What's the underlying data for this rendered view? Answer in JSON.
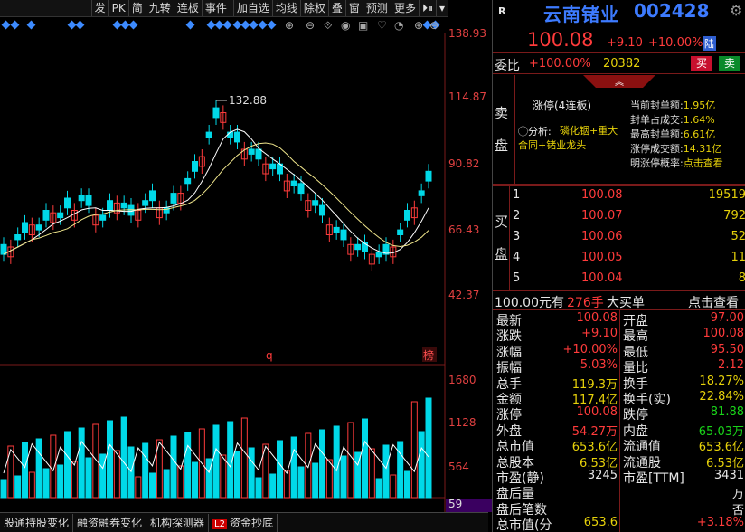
{
  "toolbar": {
    "buttons": [
      "发",
      "PK",
      "简",
      "九转",
      "连板",
      "事件",
      "加自选",
      "均线",
      "除权",
      "叠",
      "窗",
      "预测",
      "更多"
    ],
    "arrow_right": "⏵⏸",
    "arrow_down": "▾"
  },
  "chart": {
    "price_labels": [
      "138.93",
      "114.87",
      "90.82",
      "66.43",
      "42.37"
    ],
    "volume_labels": [
      "1680",
      "1128",
      "564",
      "59"
    ],
    "high_marker": "132.88",
    "q_marker": "q",
    "bang_label": "榜"
  },
  "tabs": [
    "股通持股变化",
    "融资融券变化",
    "机构探测器",
    "资金抄底"
  ],
  "tab_l2": "L2",
  "stock": {
    "name": "云南锗业",
    "code": "002428",
    "r_label": "R",
    "price": "100.08",
    "change": "+9.10",
    "pct": "+10.00%",
    "tag": "陆",
    "weibi_label": "委比",
    "weibi_value": "+100.00%",
    "weibi_num": "20382",
    "buy_btn": "买",
    "sell_btn": "卖"
  },
  "limit": {
    "side_sell": [
      "卖",
      "盘"
    ],
    "title": "涨停(4连板)",
    "analysis_prefix": "分析:",
    "analysis": "磷化铟+重大合同+锗业龙头",
    "rows": [
      {
        "label": "当前封单额:",
        "value": "1.95亿"
      },
      {
        "label": "封单占成交:",
        "value": "1.64%"
      },
      {
        "label": "最高封单额:",
        "value": "6.61亿"
      },
      {
        "label": "涨停成交额:",
        "value": "14.31亿"
      },
      {
        "label": "明涨停概率:",
        "value": "点击查看"
      }
    ]
  },
  "bids": {
    "side": [
      "买",
      "盘"
    ],
    "rows": [
      {
        "n": "1",
        "p": "100.08",
        "v": "19519"
      },
      {
        "n": "2",
        "p": "100.07",
        "v": "792"
      },
      {
        "n": "3",
        "p": "100.06",
        "v": "52"
      },
      {
        "n": "4",
        "p": "100.05",
        "v": "11"
      },
      {
        "n": "5",
        "p": "100.04",
        "v": "8"
      }
    ]
  },
  "bigorder": {
    "price": "100.00元有",
    "qty": "276手",
    "label": "大买单",
    "link": "点击查看"
  },
  "stats": [
    {
      "l": "最新",
      "v": "100.08",
      "vc": "red",
      "l2": "开盘",
      "v2": "97.00",
      "v2c": "red"
    },
    {
      "l": "涨跌",
      "v": "+9.10",
      "vc": "red",
      "l2": "最高",
      "v2": "100.08",
      "v2c": "red"
    },
    {
      "l": "涨幅",
      "v": "+10.00%",
      "vc": "red",
      "l2": "最低",
      "v2": "95.50",
      "v2c": "red"
    },
    {
      "l": "振幅",
      "v": "5.03%",
      "vc": "red",
      "l2": "量比",
      "v2": "2.12",
      "v2c": "red"
    },
    {
      "l": "总手",
      "v": "119.3万",
      "vc": "yellow",
      "l2": "换手",
      "v2": "18.27%",
      "v2c": "yellow"
    },
    {
      "l": "金额",
      "v": "117.4亿",
      "vc": "yellow",
      "l2": "换手(实)",
      "v2": "22.84%",
      "v2c": "yellow"
    },
    {
      "l": "涨停",
      "v": "100.08",
      "vc": "red",
      "l2": "跌停",
      "v2": "81.88",
      "v2c": "green"
    },
    {
      "l": "外盘",
      "v": "54.27万",
      "vc": "red",
      "l2": "内盘",
      "v2": "65.03万",
      "v2c": "green"
    },
    {
      "l": "总市值",
      "v": "653.6亿",
      "vc": "yellow",
      "l2": "流通值",
      "v2": "653.6亿",
      "v2c": "yellow"
    },
    {
      "l": "总股本",
      "v": "6.53亿",
      "vc": "yellow",
      "l2": "流通股",
      "v2": "6.53亿",
      "v2c": "yellow"
    },
    {
      "l": "市盈(静)",
      "v": "3245",
      "vc": "white",
      "l2": "市盈[TTM]",
      "v2": "3431",
      "v2c": "white"
    },
    {
      "l": "盘后量",
      "v": "",
      "vc": "white",
      "l2": "",
      "v2": "万",
      "v2c": "white"
    },
    {
      "l": "盘后笔数",
      "v": "",
      "vc": "white",
      "l2": "",
      "v2": "否",
      "v2c": "white"
    },
    {
      "l": "总市值(分",
      "v": "653.6",
      "vc": "yellow",
      "l2": "",
      "v2": "+3.18%",
      "v2c": "red"
    }
  ],
  "colors": {
    "up": "#ff3b3b",
    "down": "#00d9e8",
    "ma1": "#ffffff",
    "ma2": "#f0e68c",
    "axis": "#8b1a1a"
  }
}
